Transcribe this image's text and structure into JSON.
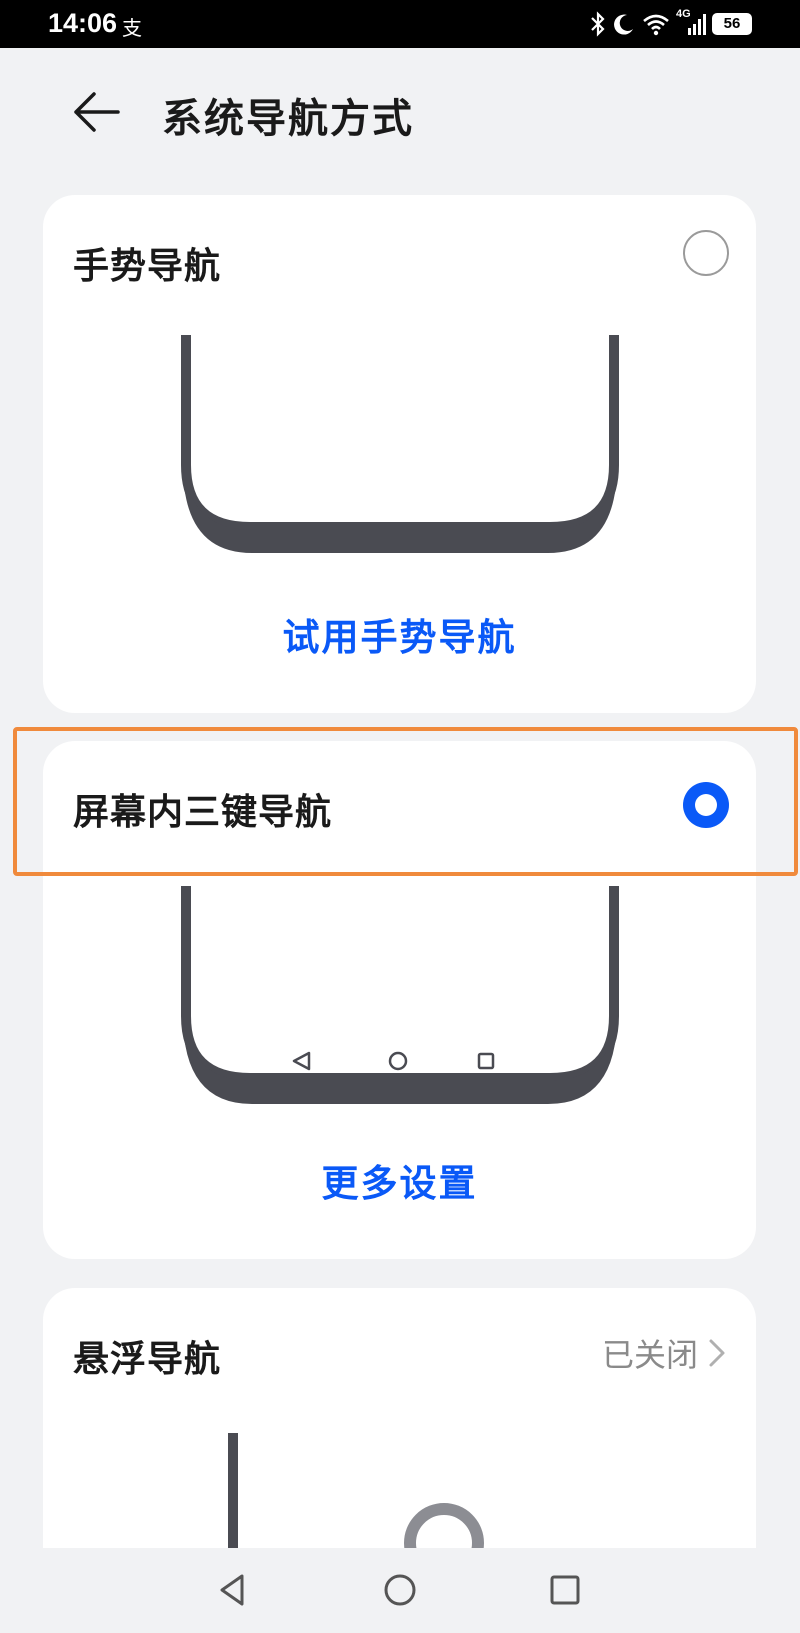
{
  "status_bar": {
    "time": "14:06",
    "carrier_glyph": "支",
    "network": "4G",
    "battery": "56",
    "icons": [
      "bluetooth-icon",
      "moon-icon",
      "wifi-icon",
      "signal-icon",
      "battery-icon"
    ]
  },
  "header": {
    "title": "系统导航方式",
    "back_icon": "back-arrow-icon"
  },
  "options": {
    "gesture": {
      "title": "手势导航",
      "selected": false,
      "link": "试用手势导航"
    },
    "three_key": {
      "title": "屏幕内三键导航",
      "selected": true,
      "link": "更多设置",
      "preview_icons": [
        "back-triangle-icon",
        "home-circle-icon",
        "recent-square-icon"
      ]
    },
    "floating": {
      "title": "悬浮导航",
      "status": "已关闭"
    }
  },
  "system_nav": {
    "icons": [
      "back-icon",
      "home-icon",
      "recents-icon"
    ]
  },
  "colors": {
    "accent": "#0a59f7",
    "highlight": "#f08a3c",
    "background": "#f1f2f4",
    "card": "#ffffff",
    "phone_frame": "#4a4b52"
  }
}
